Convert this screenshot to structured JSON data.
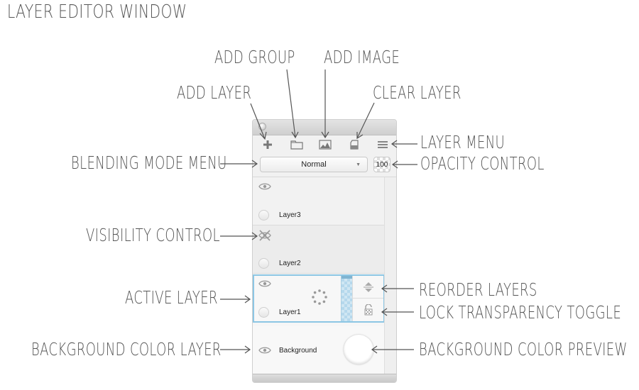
{
  "diagram_title": "Layer Editor Window",
  "annotations": {
    "add_layer": "Add Layer",
    "add_group": "Add Group",
    "add_image": "Add Image",
    "clear_layer": "Clear Layer",
    "layer_menu": "Layer Menu",
    "blending_mode_menu": "Blending Mode Menu",
    "opacity_control": "Opacity Control",
    "visibility_control": "Visibility Control",
    "active_layer": "Active Layer",
    "reorder_layers": "Reorder Layers",
    "lock_transparency_toggle": "Lock Transparency Toggle",
    "background_color_layer": "Background Color Layer",
    "background_color_preview": "Background Color Preview"
  },
  "window": {
    "toolbar": {
      "icons": [
        "plus-icon",
        "folder-icon",
        "image-icon",
        "clear-layer-icon",
        "menu-icon"
      ]
    },
    "blend_mode": {
      "selected": "Normal"
    },
    "opacity": {
      "value": "100"
    },
    "layers": [
      {
        "name": "Layer3",
        "visible": true,
        "active": false
      },
      {
        "name": "Layer2",
        "visible": false,
        "active": false
      },
      {
        "name": "Layer1",
        "visible": true,
        "active": true
      }
    ],
    "background": {
      "name": "Background",
      "color": "#ffffff",
      "visible": true
    },
    "colors": {
      "active_border": "#8cc6e4",
      "panel_bg": "#f1f1f1"
    }
  }
}
